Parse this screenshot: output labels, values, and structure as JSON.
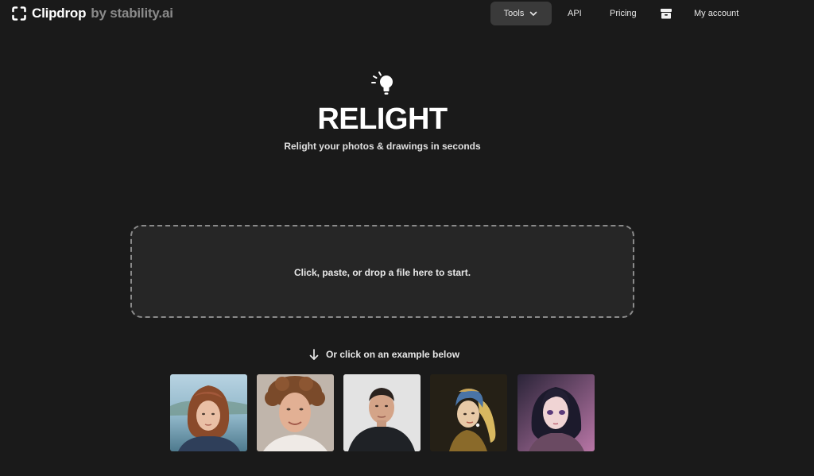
{
  "header": {
    "brand_name": "Clipdrop",
    "brand_by": "by stability.ai",
    "nav": {
      "tools": "Tools",
      "api": "API",
      "pricing": "Pricing",
      "account": "My account"
    }
  },
  "hero": {
    "title": "RELIGHT",
    "subtitle": "Relight your photos & drawings in seconds"
  },
  "dropzone": {
    "text": "Click, paste, or drop a file here to start."
  },
  "examples": {
    "hint": "Or click on an example below",
    "items": [
      {
        "name": "example-portrait-woman-lake"
      },
      {
        "name": "example-portrait-curly-man"
      },
      {
        "name": "example-portrait-man-dark-shirt"
      },
      {
        "name": "example-painting-pearl-earring"
      },
      {
        "name": "example-anime-girl"
      }
    ]
  },
  "colors": {
    "background": "#1a1a1a",
    "accent_button": "#3a3a3a",
    "dropzone_bg": "#262626",
    "dropzone_border": "#8a8a8a",
    "muted_text": "#8a8a8a"
  },
  "icons": [
    "clipdrop-logo-icon",
    "chevron-down-icon",
    "archive-box-icon",
    "lightbulb-icon",
    "arrow-down-icon"
  ]
}
